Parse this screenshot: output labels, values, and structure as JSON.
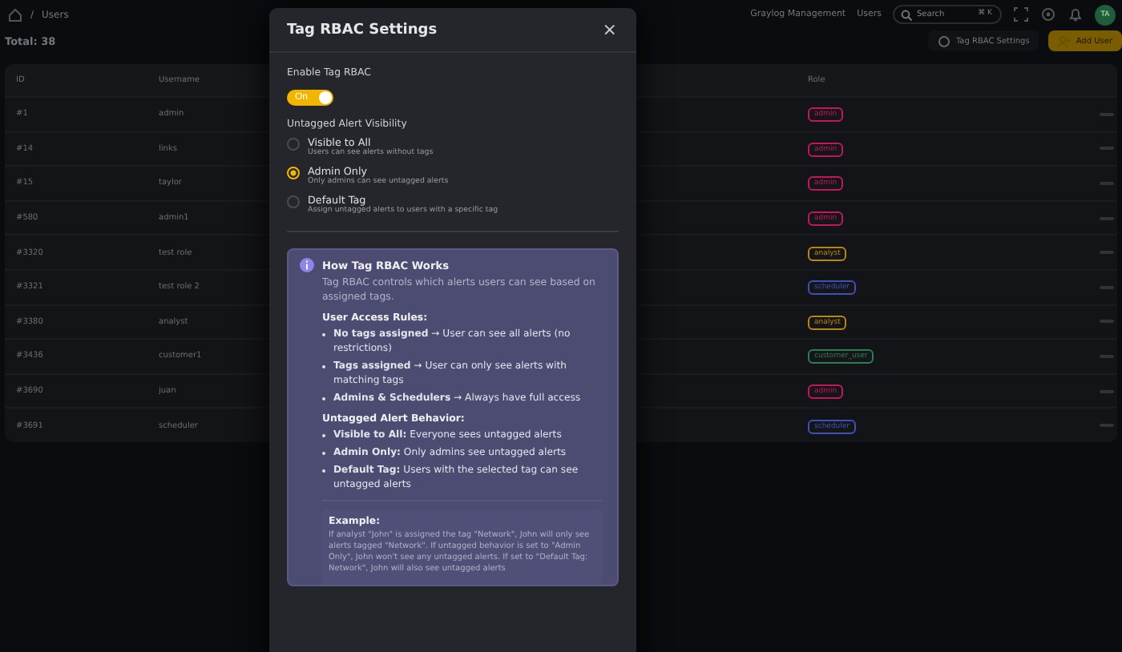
{
  "breadcrumb": {
    "separator": "/",
    "page": "Users"
  },
  "topbar": {
    "links": [
      "Graylog Management",
      "Users"
    ],
    "search": {
      "placeholder": "Search",
      "shortcut": "⌘ K"
    },
    "avatar": "TA"
  },
  "total": "Total: 38",
  "actions": [
    "Tag RBAC Settings",
    "Add User"
  ],
  "table": {
    "columns": [
      "ID",
      "Username",
      "Role"
    ],
    "rows": [
      {
        "id": "#1",
        "username": "admin",
        "role": "admin",
        "color": "#c2185b"
      },
      {
        "id": "#14",
        "username": "links",
        "role": "admin",
        "color": "#c2185b"
      },
      {
        "id": "#15",
        "username": "taylor",
        "role": "admin",
        "color": "#c2185b"
      },
      {
        "id": "#580",
        "username": "admin1",
        "role": "admin",
        "color": "#c2185b"
      },
      {
        "id": "#3320",
        "username": "test role",
        "role": "analyst",
        "color": "#b8860b"
      },
      {
        "id": "#3321",
        "username": "test role 2",
        "role": "scheduler",
        "color": "#3f51b5"
      },
      {
        "id": "#3380",
        "username": "analyst",
        "role": "analyst",
        "color": "#b8860b"
      },
      {
        "id": "#3436",
        "username": "customer1",
        "role": "customer_user",
        "color": "#2e7d52"
      },
      {
        "id": "#3690",
        "username": "juan",
        "role": "admin",
        "color": "#c2185b"
      },
      {
        "id": "#3691",
        "username": "scheduler",
        "role": "scheduler",
        "color": "#3f51b5"
      }
    ]
  },
  "modal": {
    "title": "Tag RBAC Settings",
    "close": "×",
    "enable_label": "Enable Tag RBAC",
    "toggle": {
      "label": "On",
      "on": true
    },
    "visibility_label": "Untagged Alert Visibility",
    "options": [
      {
        "label": "Visible to All",
        "hint": "Users can see alerts without tags",
        "selected": false
      },
      {
        "label": "Admin Only",
        "hint": "Only admins can see untagged alerts",
        "selected": true
      },
      {
        "label": "Default Tag",
        "hint": "Assign untagged alerts to users with a specific tag",
        "selected": false
      }
    ],
    "info": {
      "title": "How Tag RBAC Works",
      "intro": "Tag RBAC controls which alerts users can see based on assigned tags.",
      "sections": [
        {
          "heading": "User Access Rules:",
          "items": [
            "**No tags assigned** → User can see all alerts (no restrictions)",
            "**Tags assigned** → User can only see alerts with matching tags",
            "**Admins & Schedulers** → Always have full access"
          ]
        },
        {
          "heading": "Untagged Alert Behavior:",
          "items": [
            "**Visible to All:** Everyone sees untagged alerts",
            "**Admin Only:** Only admins see untagged alerts",
            "**Default Tag:** Users with the selected tag can see untagged alerts"
          ]
        }
      ],
      "example": {
        "heading": "Example:",
        "text": "If analyst \"John\" is assigned the tag \"Network\", John will only see alerts tagged \"Network\". If untagged behavior is set to \"Admin Only\", John won't see any untagged alerts. If set to \"Default Tag: Network\", John will also see untagged alerts"
      }
    }
  }
}
